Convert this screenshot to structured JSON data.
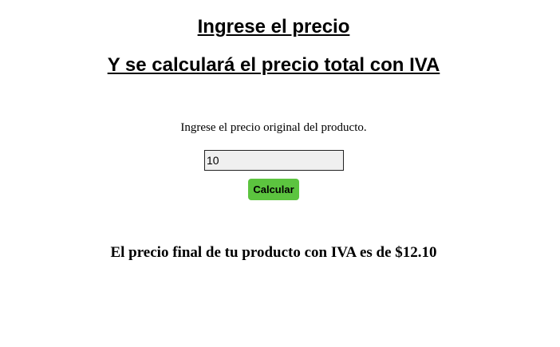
{
  "header": {
    "title_line_1": "Ingrese el precio",
    "title_line_2": "Y se calculará el precio total con IVA"
  },
  "form": {
    "instruction": "Ingrese el precio original del producto.",
    "price_value": "10",
    "calculate_label": "Calcular",
    "button_color": "#5cc43f"
  },
  "result": {
    "text": "El precio final de tu producto con IVA es de $12.10"
  }
}
